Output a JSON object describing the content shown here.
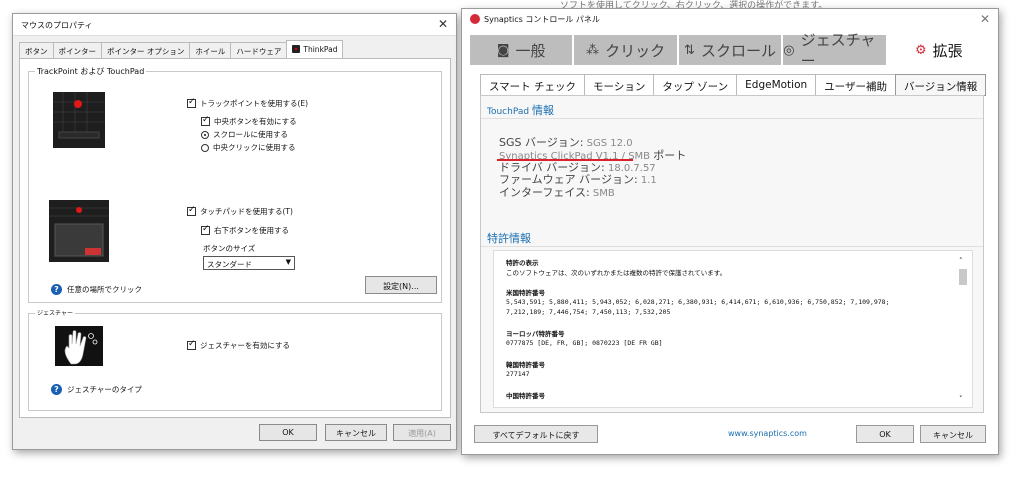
{
  "background": {
    "top_text": "ソフトを使用してクリック、右クリック、選択の操作ができます。"
  },
  "mouse_window": {
    "title": "マウスのプロパティ",
    "close_glyph": "✕",
    "tabs": [
      "ボタン",
      "ポインター",
      "ポインター オプション",
      "ホイール",
      "ハードウェア",
      "ThinkPad"
    ],
    "active_tab": "ThinkPad",
    "group_title": "TrackPoint および TouchPad",
    "trackpoint": {
      "enable_label": "トラックポイントを使用する(E)",
      "middle_enable_label": "中央ボタンを有効にする",
      "scroll_label": "スクロールに使用する",
      "middle_click_label": "中央クリックに使用する"
    },
    "touchpad": {
      "enable_label": "タッチパッドを使用する(T)",
      "right_lower_label": "右下ボタンを使用する",
      "button_size_label": "ボタンのサイズ",
      "button_size_value": "スタンダード"
    },
    "settings_button": "設定(N)...",
    "click_anywhere_label": "任意の場所でクリック",
    "gesture_group_title": "ジェスチャー",
    "gesture_enable_label": "ジェスチャーを有効にする",
    "gesture_types_label": "ジェスチャーのタイプ",
    "buttons": {
      "ok": "OK",
      "cancel": "キャンセル",
      "apply": "適用(A)"
    }
  },
  "synaptics_window": {
    "title": "Synaptics コントロール パネル",
    "close_glyph": "✕",
    "main_tabs": [
      {
        "icon": "◙",
        "label": "一般"
      },
      {
        "icon": "⁂",
        "label": "クリック"
      },
      {
        "icon": "⇅",
        "label": "スクロール"
      },
      {
        "icon": "◎",
        "label": "ジェスチャー"
      },
      {
        "icon": "⚙",
        "label": "拡張"
      }
    ],
    "sub_tabs": [
      "スマート チェック",
      "モーション",
      "タップ ゾーン",
      "EdgeMotion",
      "ユーザー補助",
      "バージョン情報"
    ],
    "touchpad_info": {
      "title_prefix": "TouchPad",
      "title_suffix": "情報",
      "sgs_label": "SGS バージョン:",
      "sgs_value": "SGS 12.0",
      "clickpad_label": "Synaptics ClickPad V1.1 / SMB",
      "clickpad_suffix": "ポート",
      "driver_label": "ドライバ バージョン:",
      "driver_value": "18.0.7.57",
      "firmware_label": "ファームウェア バージョン:",
      "firmware_value": "1.1",
      "interface_label": "インターフェイス:",
      "interface_value": "SMB"
    },
    "patent_title": "特許情報",
    "patent": {
      "display_heading": "特許の表示",
      "display_text": "このソフトウェアは、次のいずれかまたは複数の特許で保護されています。",
      "us_heading": "米国特許番号",
      "us_line1": "5,543,591; 5,880,411; 5,943,052; 6,028,271; 6,380,931; 6,414,671; 6,610,936; 6,750,852; 7,109,978;",
      "us_line2": "7,212,189; 7,446,754; 7,450,113; 7,532,205",
      "eu_heading": "ヨーロッパ特許番号",
      "eu_line": "0777875 [DE, FR, GB]; 0870223 [DE FR GB]",
      "kr_heading": "韓国特許番号",
      "kr_line": "277147",
      "cn_heading": "中国特許番号"
    },
    "reset_button": "すべてデフォルトに戻す",
    "website": "www.synaptics.com",
    "buttons": {
      "ok": "OK",
      "cancel": "キャンセル"
    }
  }
}
